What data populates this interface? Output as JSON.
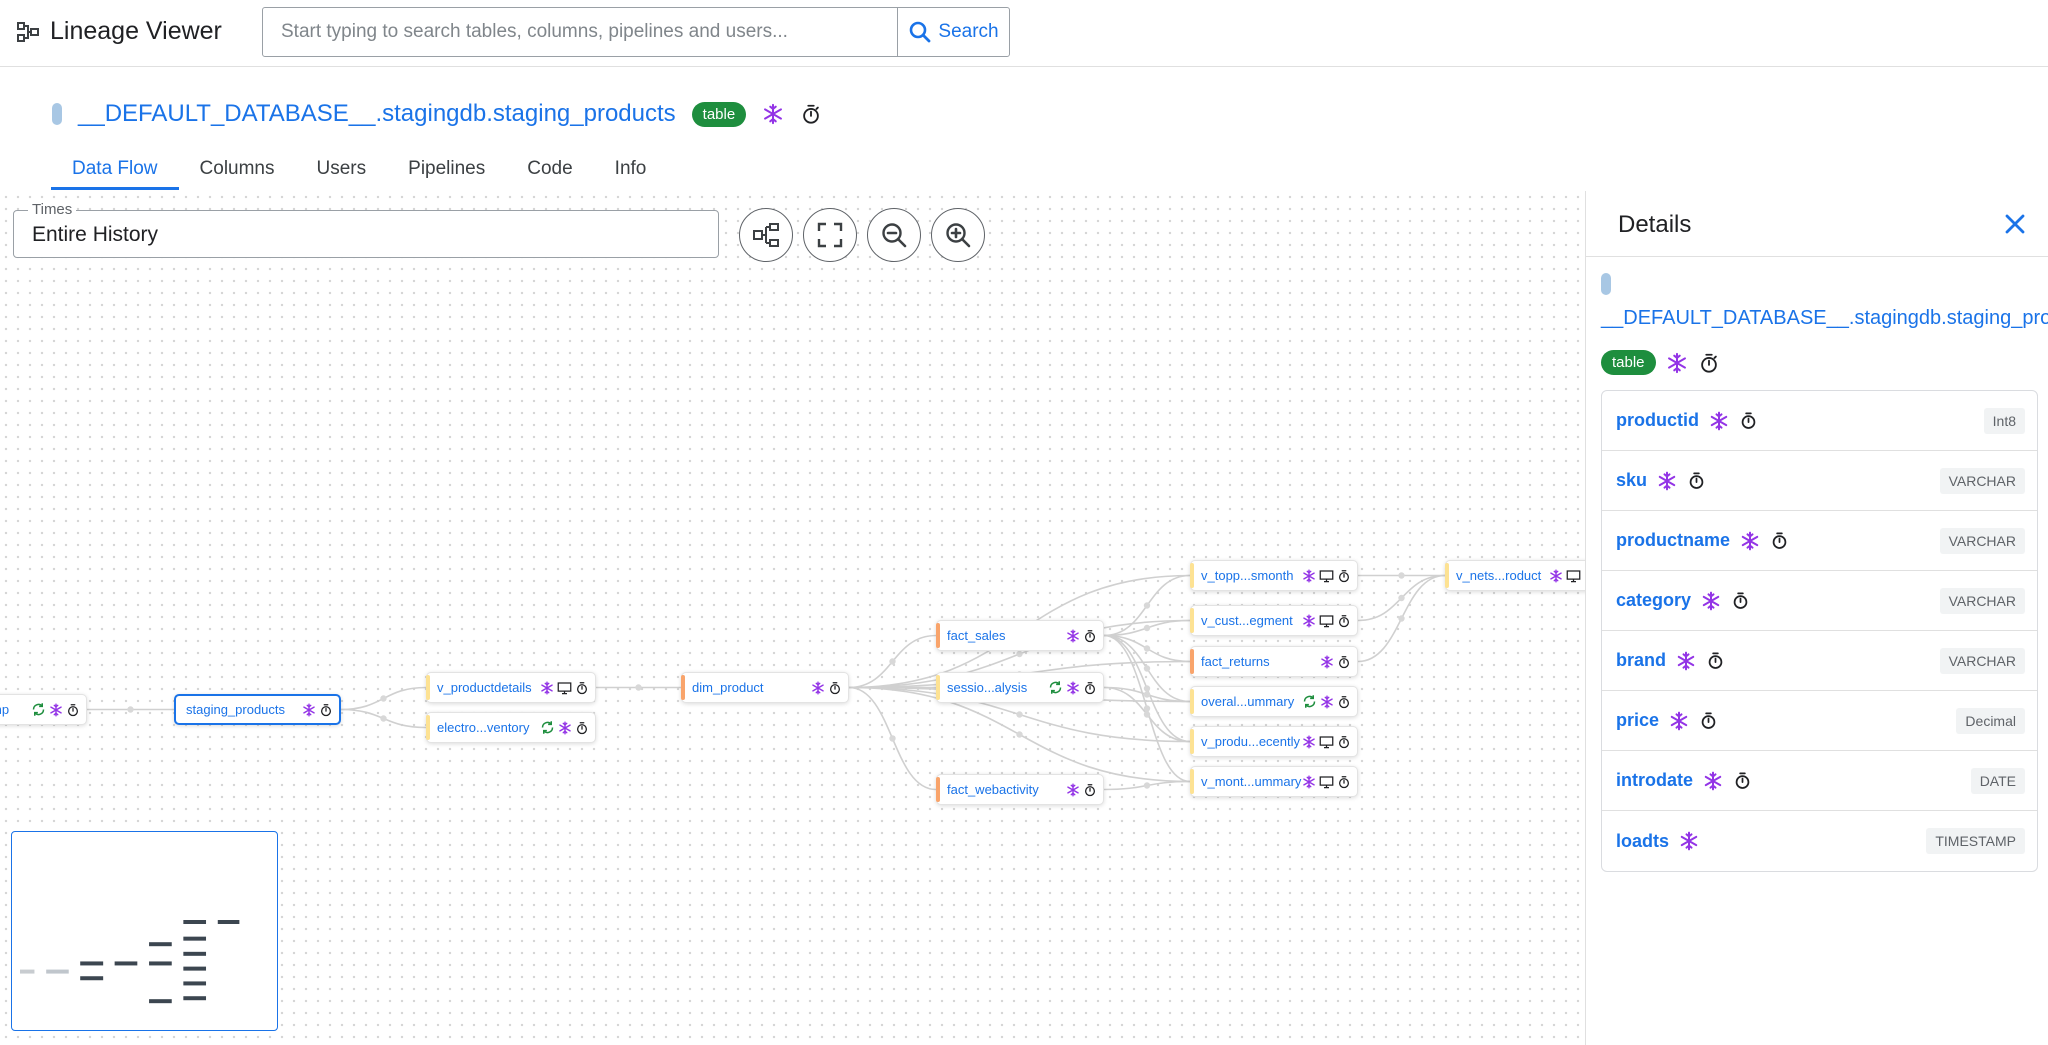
{
  "app": {
    "title": "Lineage Viewer"
  },
  "search": {
    "placeholder": "Start typing to search tables, columns, pipelines and users...",
    "button_label": "Search"
  },
  "asset": {
    "pill_color": "#a8c7e4",
    "title": "__DEFAULT_DATABASE__.stagingdb.staging_products",
    "badge": "table"
  },
  "tabs": [
    {
      "label": "Data Flow",
      "active": true
    },
    {
      "label": "Columns"
    },
    {
      "label": "Users"
    },
    {
      "label": "Pipelines"
    },
    {
      "label": "Code"
    },
    {
      "label": "Info"
    }
  ],
  "controls": {
    "times_label": "Times",
    "times_value": "Entire History"
  },
  "graph": {
    "nodes": [
      {
        "id": "n0",
        "label": "mp"
      },
      {
        "id": "n1",
        "label": "staging_products"
      },
      {
        "id": "n2",
        "label": "v_productdetails"
      },
      {
        "id": "n3",
        "label": "electro...ventory"
      },
      {
        "id": "n4",
        "label": "dim_product"
      },
      {
        "id": "n5",
        "label": "fact_sales"
      },
      {
        "id": "n6",
        "label": "sessio...alysis"
      },
      {
        "id": "n7",
        "label": "fact_webactivity"
      },
      {
        "id": "n8",
        "label": "v_topp...smonth"
      },
      {
        "id": "n9",
        "label": "v_cust...egment"
      },
      {
        "id": "n10",
        "label": "fact_returns"
      },
      {
        "id": "n11",
        "label": "overal...ummary"
      },
      {
        "id": "n12",
        "label": "v_produ...ecently"
      },
      {
        "id": "n13",
        "label": "v_mont...ummary"
      },
      {
        "id": "n14",
        "label": "v_nets...roduct"
      }
    ]
  },
  "details": {
    "title": "Details",
    "asset_link": "__DEFAULT_DATABASE__.stagingdb.staging_products",
    "badge": "table",
    "columns": [
      {
        "name": "productid",
        "type": "Int8",
        "icons": [
          "snowflake-icon",
          "timer-icon"
        ]
      },
      {
        "name": "sku",
        "type": "VARCHAR",
        "icons": [
          "snowflake-icon",
          "timer-icon"
        ]
      },
      {
        "name": "productname",
        "type": "VARCHAR",
        "icons": [
          "snowflake-icon",
          "timer-icon"
        ]
      },
      {
        "name": "category",
        "type": "VARCHAR",
        "icons": [
          "snowflake-icon",
          "timer-icon"
        ]
      },
      {
        "name": "brand",
        "type": "VARCHAR",
        "icons": [
          "snowflake-icon",
          "timer-icon"
        ]
      },
      {
        "name": "price",
        "type": "Decimal",
        "icons": [
          "snowflake-icon",
          "timer-icon"
        ]
      },
      {
        "name": "introdate",
        "type": "DATE",
        "icons": [
          "snowflake-icon",
          "timer-icon"
        ]
      },
      {
        "name": "loadts",
        "type": "TIMESTAMP",
        "icons": [
          "snowflake-icon"
        ]
      }
    ]
  },
  "colors": {
    "accent": "#1a73e8",
    "badge_green": "#1e8e3e",
    "snowflake": "#9334e6",
    "sync": "#1e8e3e",
    "node_orange": "#f9a46b",
    "node_yellow": "#fde293"
  }
}
